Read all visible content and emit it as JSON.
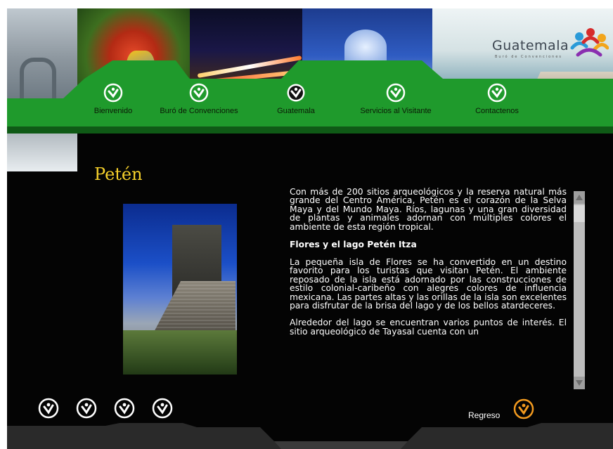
{
  "header": {
    "brand_name": "Guatemala",
    "brand_tagline": "Buró de Convenciones"
  },
  "nav": {
    "items": [
      {
        "label": "Bienvenido"
      },
      {
        "label": "Buró de Convenciones"
      },
      {
        "label": "Guatemala"
      },
      {
        "label": "Servicios al Visitante"
      },
      {
        "label": "Contactenos"
      }
    ],
    "active_index": 2
  },
  "colors": {
    "nav_green": "#1f9a2c",
    "title_yellow": "#f5d02b",
    "accent_orange": "#f29a1f",
    "background": "#040404"
  },
  "content": {
    "title": "Petén",
    "paragraphs": [
      "Con más de 200 sitios arqueológicos y la reserva natural más grande del Centro América, Petén es el corazón de la Selva Maya y del Mundo Maya. Ríos, lagunas y una gran diversidad de plantas y animales adornan con múltiples colores el ambiente de esta región tropical.",
      "La pequeña isla de Flores se ha convertido en un destino favorito para los turistas que visitan Petén. El ambiente reposado de la isla está adornado por las construcciones de estilo colonial-caribeño con alegres colores de influencia mexicana. Las partes altas y las orillas de la isla son excelentes para disfrutar de la brisa del lago y de los bellos atardeceres.",
      "Alrededor del lago se encuentran varios puntos de interés. El sitio arqueológico de Tayasal cuenta con un"
    ],
    "subheading": "Flores y el lago Petén Itza"
  },
  "gallery": {
    "icons": [
      "check-circle-icon",
      "check-circle-icon",
      "check-circle-icon",
      "check-circle-icon"
    ]
  },
  "back": {
    "label": "Regreso"
  }
}
